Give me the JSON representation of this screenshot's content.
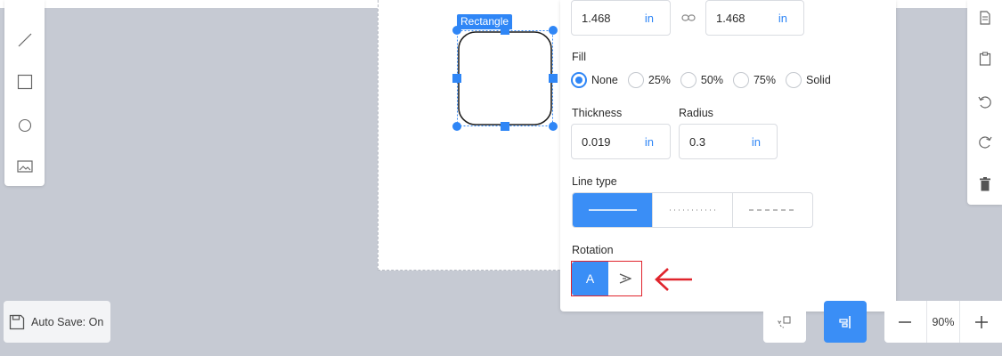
{
  "toolbar_left": {
    "tools": [
      "line-icon",
      "rectangle-icon",
      "circle-icon",
      "image-icon"
    ]
  },
  "canvas": {
    "selected_shape_label": "Rectangle"
  },
  "panel": {
    "width": {
      "value": "1.468",
      "unit": "in"
    },
    "height": {
      "value": "1.468",
      "unit": "in"
    },
    "fill": {
      "label": "Fill",
      "options": [
        "None",
        "25%",
        "50%",
        "75%",
        "Solid"
      ],
      "selected": "None"
    },
    "thickness": {
      "label": "Thickness",
      "value": "0.019",
      "unit": "in"
    },
    "radius": {
      "label": "Radius",
      "value": "0.3",
      "unit": "in"
    },
    "line_type": {
      "label": "Line type",
      "options": [
        "solid",
        "dotted",
        "dashed"
      ],
      "selected": "solid"
    },
    "rotation": {
      "label": "Rotation",
      "option_a": "A",
      "option_b": ">",
      "selected": "A"
    }
  },
  "toolbar_right": {
    "tools": [
      "copy-icon",
      "paste-icon",
      "undo-icon",
      "redo-icon",
      "delete-icon"
    ]
  },
  "bottom": {
    "autosave_label": "Auto Save: On",
    "zoom_value": "90%"
  },
  "colors": {
    "accent": "#2f86f6",
    "highlight": "#e0242c",
    "background": "#c6cad3"
  }
}
